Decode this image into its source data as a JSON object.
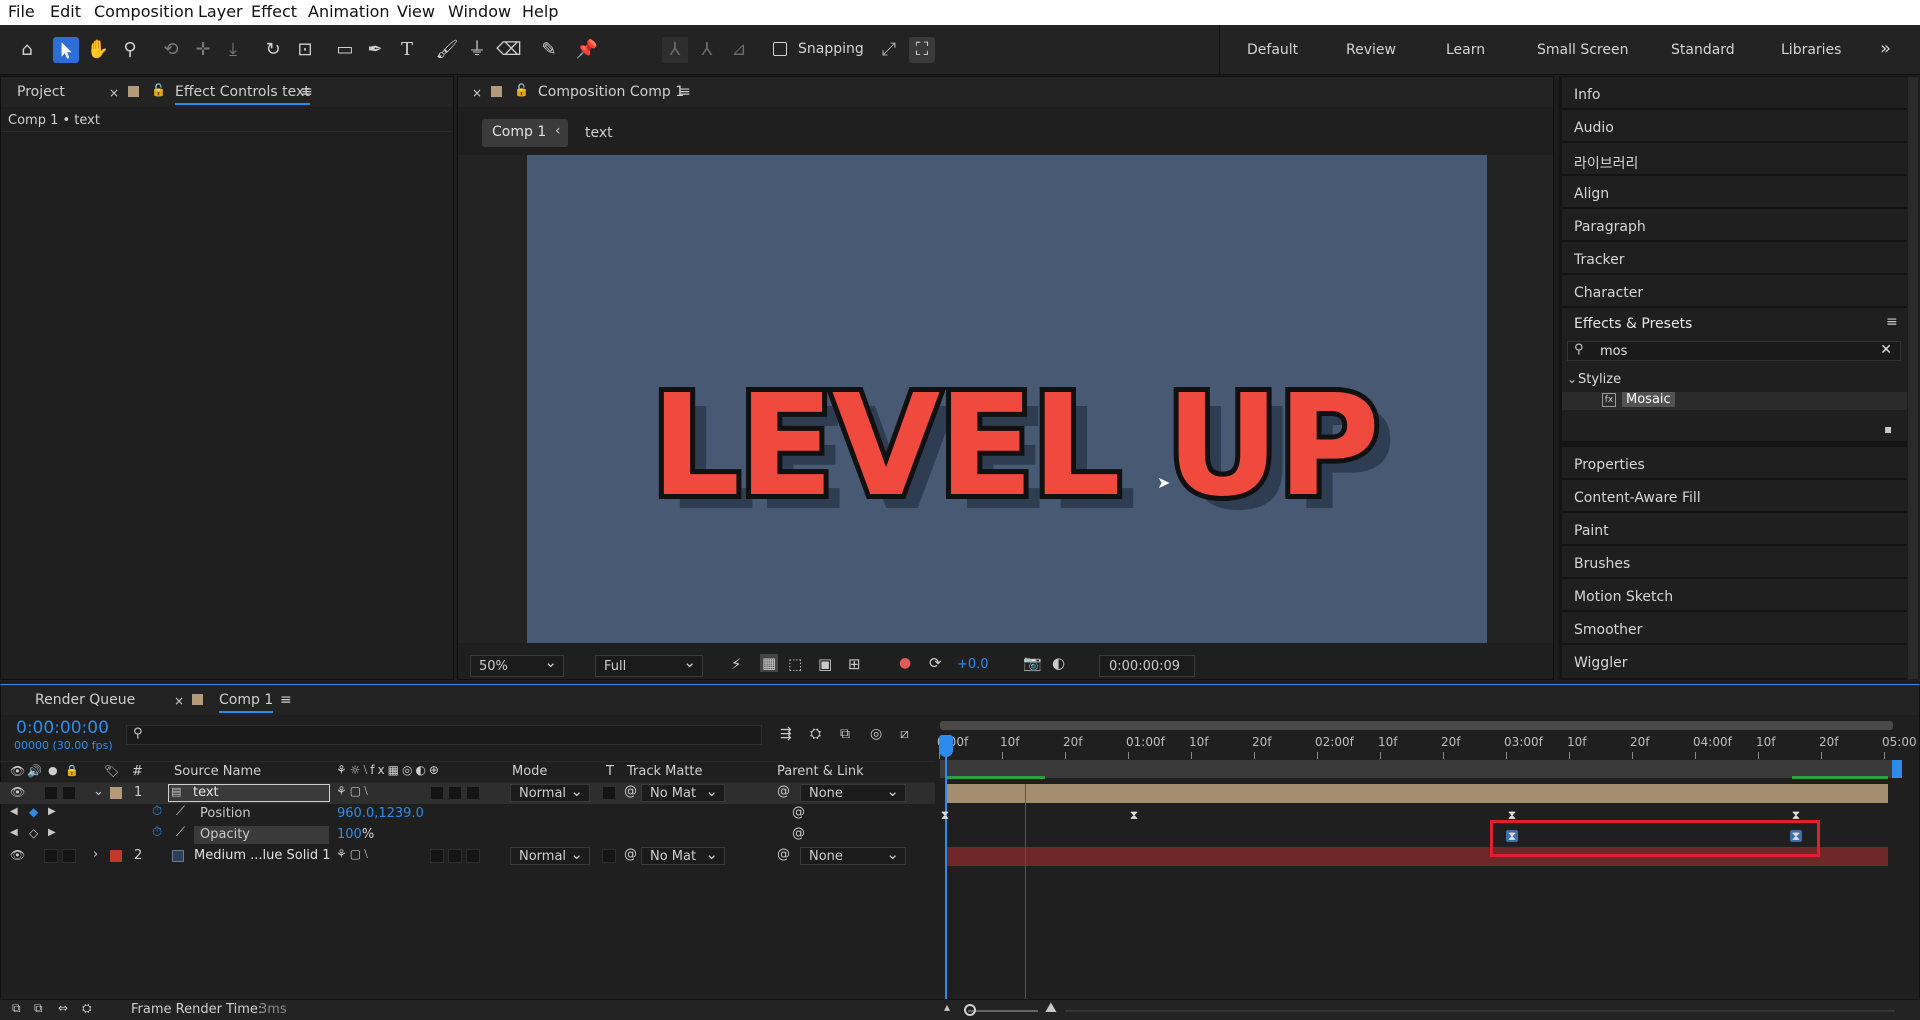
{
  "menu": [
    "File",
    "Edit",
    "Composition",
    "Layer",
    "Effect",
    "Animation",
    "View",
    "Window",
    "Help"
  ],
  "toolbar": {
    "snapping_label": "Snapping",
    "snapping_checked": false
  },
  "workspaces": [
    "Default",
    "Review",
    "Learn",
    "Small Screen",
    "Standard",
    "Libraries"
  ],
  "workspaces_more": "»",
  "left_panel": {
    "tab_project": "Project",
    "tab_effect_controls": "Effect Controls text",
    "breadcrumb": "Comp 1 • text"
  },
  "composition": {
    "tab_title": "Composition Comp 1",
    "crumb_comp": "Comp 1",
    "crumb_layer": "text",
    "canvas_text": "LEVEL UP",
    "zoom": "50%",
    "resolution": "Full",
    "exposure": "+0.0",
    "timecode": "0:00:00:09"
  },
  "right_panel": {
    "items_top": [
      "Info",
      "Audio",
      "라이브러리",
      "Align",
      "Paragraph",
      "Tracker",
      "Character"
    ],
    "effects_title": "Effects & Presets",
    "search_value": "mos",
    "category": "Stylize",
    "effect": "Mosaic",
    "items_bottom": [
      "Properties",
      "Content-Aware Fill",
      "Paint",
      "Brushes",
      "Motion Sketch",
      "Smoother",
      "Wiggler"
    ]
  },
  "timeline": {
    "tab_render_queue": "Render Queue",
    "tab_comp": "Comp 1",
    "current_time": "0:00:00:00",
    "frame_info": "00000 (30.00 fps)",
    "headers": {
      "source_name": "Source Name",
      "mode": "Mode",
      "t": "T",
      "track_matte": "Track Matte",
      "parent": "Parent & Link",
      "num": "#"
    },
    "layers": [
      {
        "num": "1",
        "name": "text",
        "mode": "Normal",
        "matte": "No Mat",
        "parent": "None",
        "color": "#b49a78"
      },
      {
        "num": "2",
        "name": "Medium ...lue Solid 1",
        "mode": "Normal",
        "matte": "No Mat",
        "parent": "None",
        "color": "#c0392b"
      }
    ],
    "properties": [
      {
        "name": "Position",
        "value": "960.0,1239.0"
      },
      {
        "name": "Opacity",
        "value": "100",
        "unit": "%"
      }
    ],
    "ruler": [
      "0:00f",
      "10f",
      "20f",
      "01:00f",
      "10f",
      "20f",
      "02:00f",
      "10f",
      "20f",
      "03:00f",
      "10f",
      "20f",
      "04:00f",
      "10f",
      "20f",
      "05:00"
    ],
    "frame_render_label": "Frame Render Time:",
    "frame_render_value": "3ms"
  },
  "colors": {
    "accent": "#2d8ceb",
    "highlight_box": "#e0202e",
    "canvas_bg": "#475973",
    "text_red": "#f0493e"
  }
}
